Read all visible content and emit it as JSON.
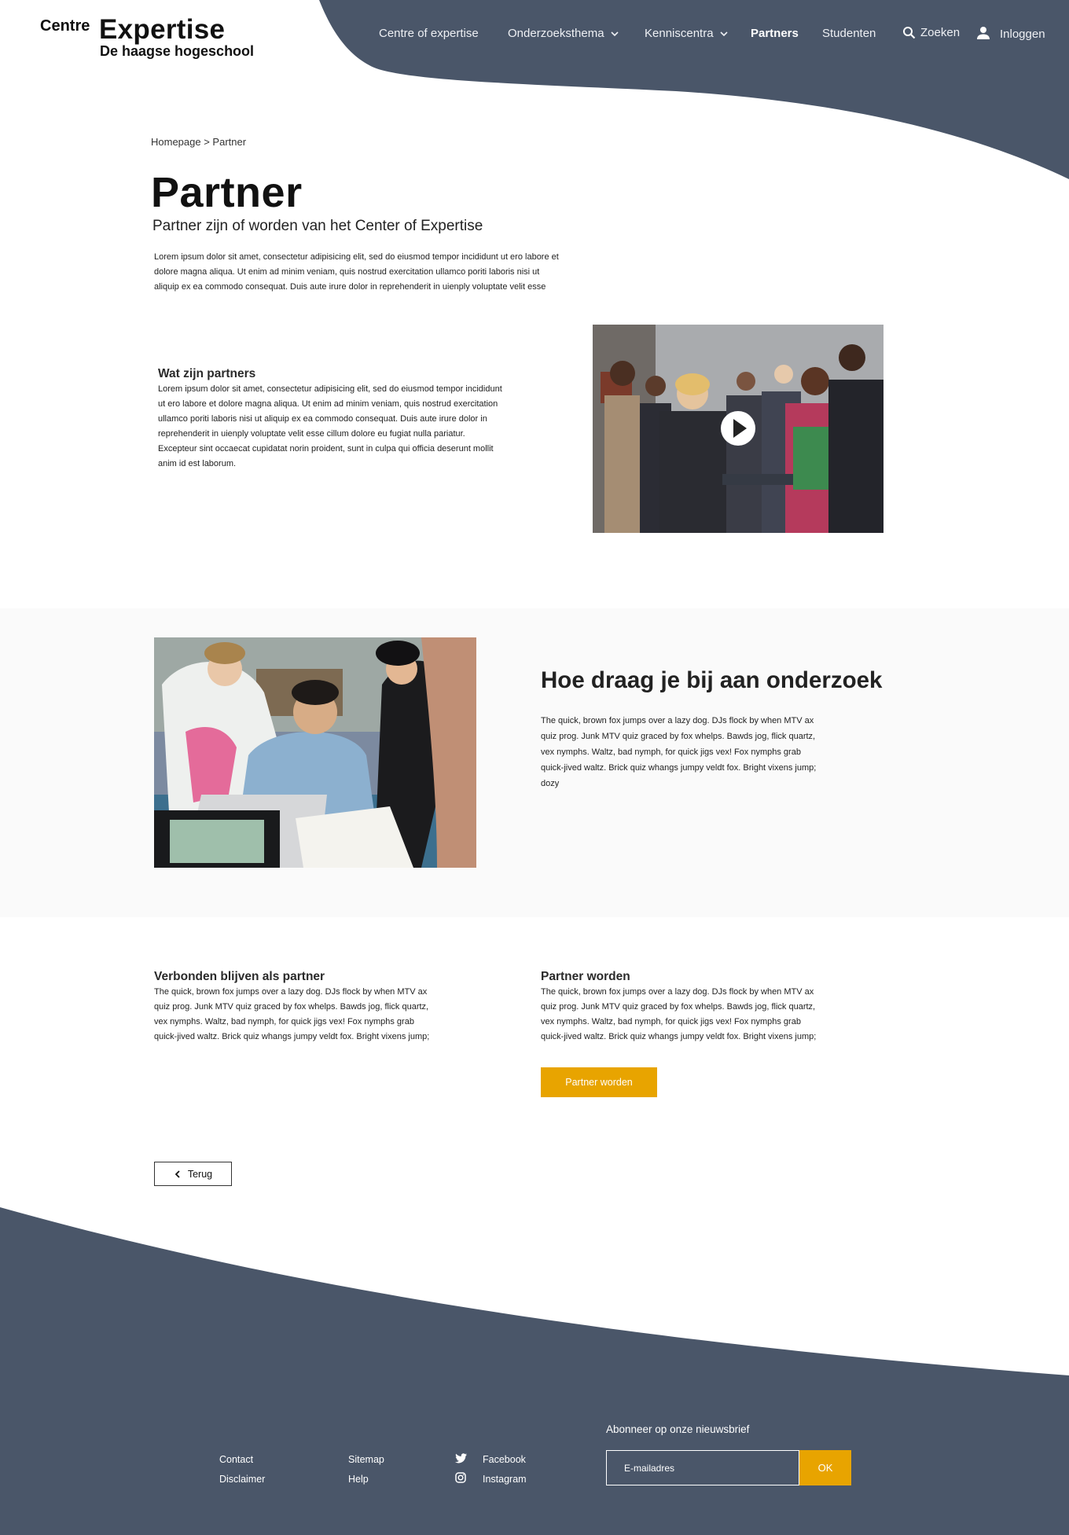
{
  "header": {
    "logo_small": "Centre",
    "logo_big": "Expertise",
    "logo_sub": "De haagse hogeschool",
    "nav": {
      "centre": "Centre of expertise",
      "themes": "Onderzoeksthema",
      "knowledge": "Kenniscentra",
      "partners": "Partners",
      "students": "Studenten"
    },
    "search_label": "Zoeken",
    "login_label": "Inloggen"
  },
  "breadcrumb": "Homepage > Partner",
  "page": {
    "title": "Partner",
    "subtitle": "Partner zijn of worden van het Center of Expertise",
    "intro": [
      "Lorem ipsum dolor sit amet, consectetur adipisicing elit, sed do eiusmod tempor incididunt ut ero labore et",
      "dolore magna aliqua. Ut enim ad minim veniam, quis nostrud exercitation ullamco poriti laboris nisi ut",
      "aliquip ex ea commodo consequat. Duis aute irure dolor in reprehenderit in uienply voluptate velit esse"
    ]
  },
  "partners_section": {
    "heading": "Wat zijn partners",
    "lines": [
      "Lorem ipsum dolor sit amet, consectetur adipisicing elit, sed do eiusmod tempor incididunt",
      "ut ero labore et dolore magna aliqua. Ut enim ad minim veniam, quis nostrud exercitation",
      "ullamco poriti laboris nisi ut aliquip ex ea commodo consequat. Duis aute irure dolor in",
      "reprehenderit in uienply voluptate velit esse cillum dolore eu fugiat nulla pariatur.",
      "Excepteur sint occaecat cupidatat norin proident, sunt in culpa qui officia deserunt mollit",
      "anim id est laborum."
    ]
  },
  "research_section": {
    "heading": "Hoe draag je bij aan onderzoek",
    "lines": [
      "The quick, brown fox jumps over a lazy dog. DJs flock by when MTV ax",
      "quiz prog. Junk MTV quiz graced by fox whelps. Bawds jog, flick quartz,",
      "vex nymphs. Waltz, bad nymph, for quick jigs vex! Fox nymphs grab",
      "quick-jived waltz. Brick quiz whangs jumpy veldt fox. Bright vixens jump;",
      "dozy"
    ]
  },
  "connected_section": {
    "heading": "Verbonden blijven als partner",
    "lines": [
      "The quick, brown fox jumps over a lazy dog. DJs flock by when MTV ax",
      "quiz prog. Junk MTV quiz graced by fox whelps. Bawds jog, flick quartz,",
      "vex nymphs. Waltz, bad nymph, for quick jigs vex! Fox nymphs grab",
      "quick-jived waltz. Brick quiz whangs jumpy veldt fox. Bright vixens jump;"
    ]
  },
  "become_section": {
    "heading": "Partner worden",
    "lines": [
      "The quick, brown fox jumps over a lazy dog. DJs flock by when MTV ax",
      "quiz prog. Junk MTV quiz graced by fox whelps. Bawds jog, flick quartz,",
      "vex nymphs. Waltz, bad nymph, for quick jigs vex! Fox nymphs grab",
      "quick-jived waltz. Brick quiz whangs jumpy veldt fox. Bright vixens jump;"
    ],
    "button": "Partner worden"
  },
  "back_button": "Terug",
  "footer": {
    "links": {
      "contact": "Contact",
      "disclaimer": "Disclaimer",
      "sitemap": "Sitemap",
      "help": "Help",
      "facebook": "Facebook",
      "instagram": "Instagram"
    },
    "newsletter_title": "Abonneer op onze nieuwsbrief",
    "newsletter_placeholder": "E-mailadres",
    "newsletter_button": "OK"
  },
  "colors": {
    "navy": "#4a5669",
    "accent": "#e8a400",
    "band": "#fafafa"
  }
}
